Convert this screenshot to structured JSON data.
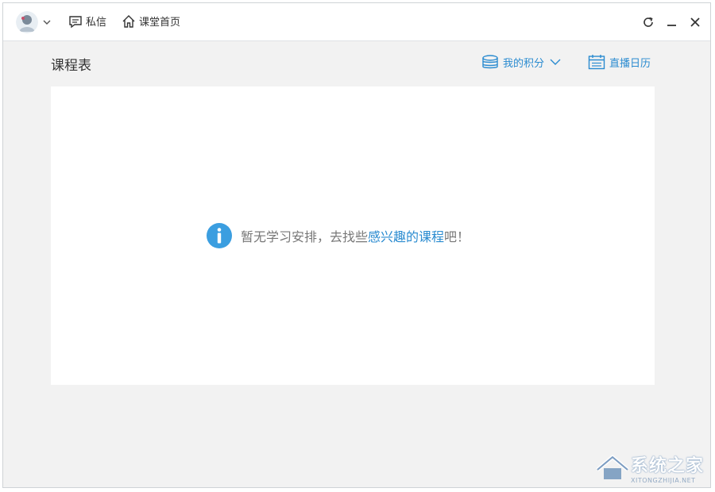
{
  "topbar": {
    "messages_label": "私信",
    "home_label": "课堂首页"
  },
  "header": {
    "title": "课程表",
    "points_label": "我的积分",
    "calendar_label": "直播日历"
  },
  "empty_state": {
    "prefix": "暂无学习安排，去找些",
    "link": "感兴趣的课程",
    "suffix": "吧！"
  },
  "watermark": {
    "text": "系统之家",
    "sub": "XITONGZHIJIA.NET"
  },
  "colors": {
    "accent": "#2a8bd0",
    "background": "#f2f2f2"
  }
}
